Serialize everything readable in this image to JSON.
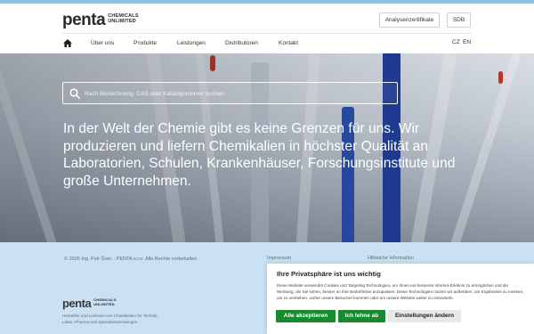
{
  "header": {
    "logo_text": "penta",
    "logo_sub_line1": "CHEMICALS",
    "logo_sub_line2": "UNLIMITED",
    "buttons": {
      "certificates": "Analysenzertifikate",
      "sdb": "SDB"
    }
  },
  "nav": {
    "items": [
      {
        "label": "Über uns"
      },
      {
        "label": "Produkte"
      },
      {
        "label": "Leistungen"
      },
      {
        "label": "Distributoren"
      },
      {
        "label": "Kontakt"
      }
    ],
    "languages": [
      "CZ",
      "EN"
    ]
  },
  "hero": {
    "search_placeholder": "Nach Bezeichnung, CAS oder Katalognummer suchen",
    "headline": "In der Welt der Chemie gibt es keine Grenzen für uns. Wir produzieren und liefern Chemikalien in höchster Qualität an Laboratorien, Schulen, Krankenhäuser, Forschungsinstitute und große Unternehmen."
  },
  "footer": {
    "copyright": "© 2025 Ing. Petr Švec - PENTA s.r.o. Alle Rechte vorbehalten.",
    "link_impressum": "Impressum",
    "link_info": "Hilfreiche Information",
    "logo_text": "penta",
    "logo_sub_line1": "CHEMICALS",
    "logo_sub_line2": "UNLIMITED",
    "tagline": "Hersteller und Lieferant von Chemikalien für Technik, Labor, Pharma und Spezialanwendungen"
  },
  "cookie": {
    "title": "Ihre Privatsphäre ist uns wichtig",
    "text": "Diese Website verwendet Cookies und Targeting Technologien, um Ihnen ein besseres Internet-Erlebnis zu ermöglichen und die Werbung, die Sie sehen, besser an Ihre Bedürfnisse anzupassen. Diese Technologien nutzen wir außerdem, um Ergebnisse zu messen, um zu verstehen, woher unsere Besucher kommen oder um unsere Website weiter zu entwickeln.",
    "accept_label": "Alle akzeptieren",
    "reject_label": "Ich lehne ab",
    "settings_label": "Einstellungen ändern"
  },
  "colors": {
    "accent_blue": "#8fc3e3",
    "footer_bg": "#c9e1f3",
    "cookie_green": "#1a8a2e"
  },
  "icons": [
    "home-icon",
    "search-icon"
  ]
}
